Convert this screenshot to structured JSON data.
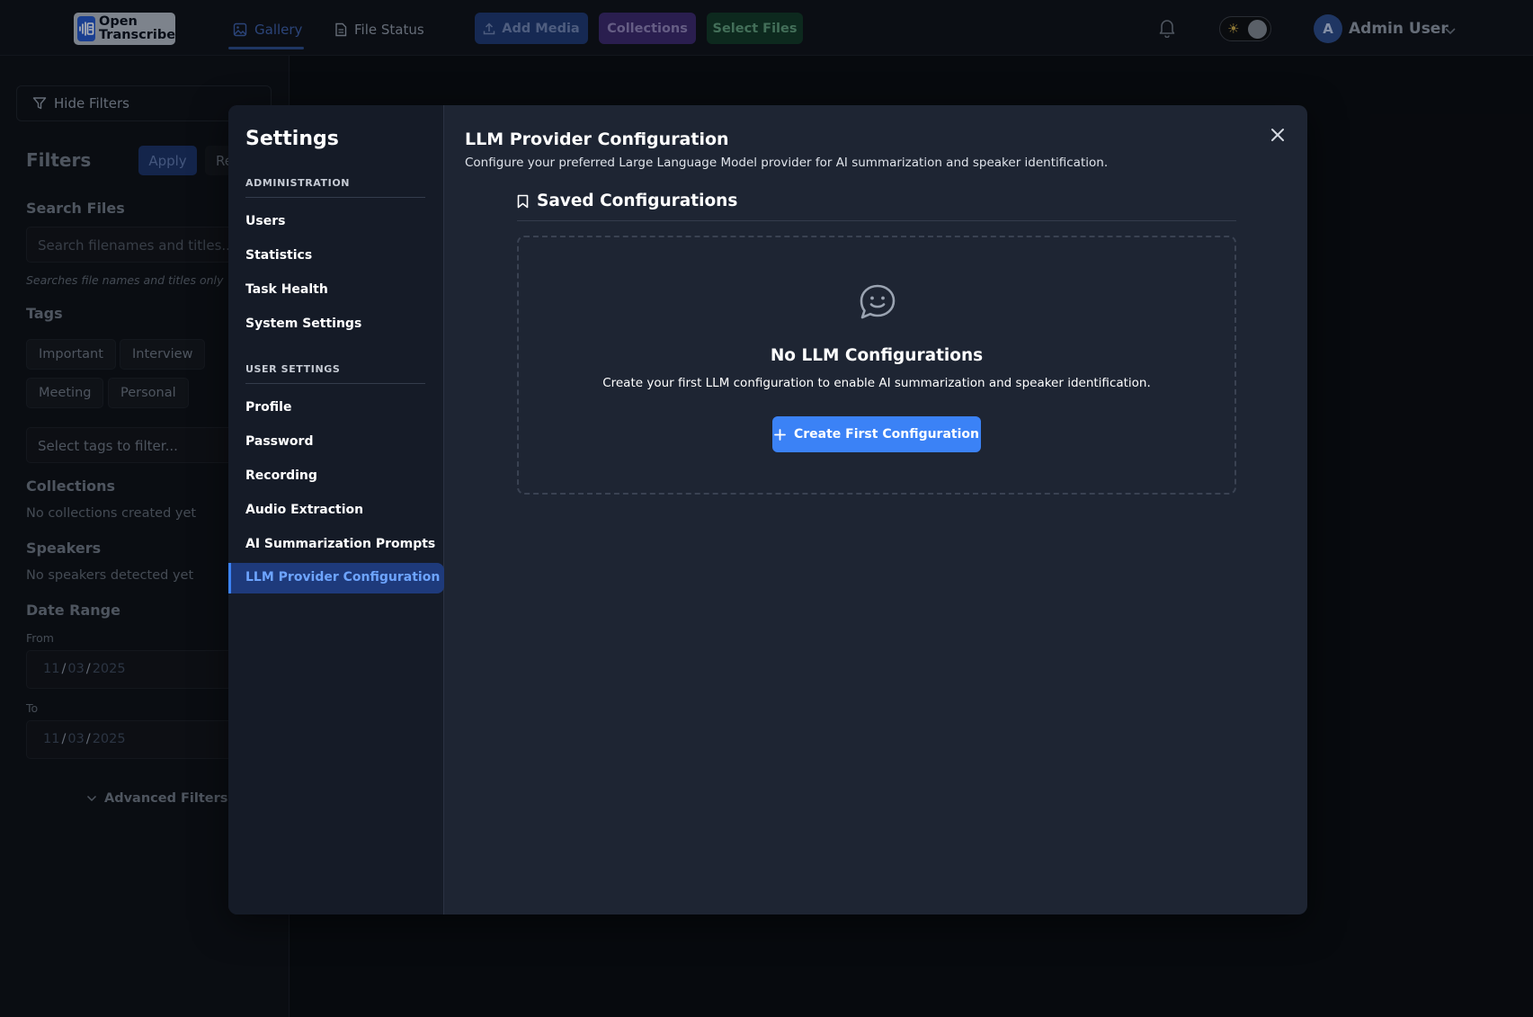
{
  "app": {
    "logo_line1": "Open",
    "logo_line2": "Transcribe"
  },
  "nav": {
    "gallery": "Gallery",
    "file_status": "File Status",
    "add_media": "Add Media",
    "collections": "Collections",
    "select_files": "Select Files",
    "user_initial": "A",
    "user_name": "Admin User"
  },
  "filters": {
    "hide_filters": "Hide Filters",
    "title": "Filters",
    "apply": "Apply",
    "reset": "Re",
    "search_heading": "Search Files",
    "search_placeholder": "Search filenames and titles...",
    "search_hint": "Searches file names and titles only",
    "tags_heading": "Tags",
    "tags": [
      "Important",
      "Interview",
      "Meeting",
      "Personal"
    ],
    "select_tags": "Select tags to filter...",
    "collections_heading": "Collections",
    "collections_empty": "No collections created yet",
    "speakers_heading": "Speakers",
    "speakers_empty": "No speakers detected yet",
    "date_heading": "Date Range",
    "from_label": "From",
    "to_label": "To",
    "date_from": {
      "mm": "11",
      "dd": "03",
      "yyyy": "2025"
    },
    "date_to": {
      "mm": "11",
      "dd": "03",
      "yyyy": "2025"
    },
    "advanced": "Advanced Filters"
  },
  "settings": {
    "title": "Settings",
    "sections": [
      {
        "label": "ADMINISTRATION",
        "items": [
          "Users",
          "Statistics",
          "Task Health",
          "System Settings"
        ]
      },
      {
        "label": "USER SETTINGS",
        "items": [
          "Profile",
          "Password",
          "Recording",
          "Audio Extraction",
          "AI Summarization Prompts",
          "LLM Provider Configuration"
        ]
      }
    ],
    "active_item": "LLM Provider Configuration"
  },
  "content": {
    "title": "LLM Provider Configuration",
    "subtitle": "Configure your preferred Large Language Model provider for AI summarization and speaker identification.",
    "saved_title": "Saved Configurations",
    "empty_title": "No LLM Configurations",
    "empty_text": "Create your first LLM configuration to enable AI summarization and speaker identification.",
    "create_button": "Create First Configuration"
  },
  "colors": {
    "accent": "#3b82f6",
    "modal_bg": "#1e2533",
    "nav_active_bg": "#1e3a7b"
  }
}
